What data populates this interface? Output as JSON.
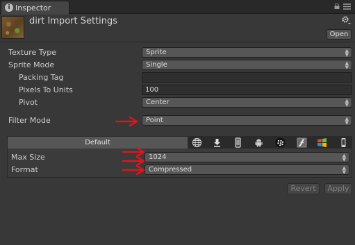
{
  "tab": {
    "label": "Inspector"
  },
  "header": {
    "title": "dirt Import Settings",
    "open_label": "Open"
  },
  "settings": {
    "texture_type": {
      "label": "Texture Type",
      "value": "Sprite"
    },
    "sprite_mode": {
      "label": "Sprite Mode",
      "value": "Single"
    },
    "packing_tag": {
      "label": "Packing Tag",
      "value": ""
    },
    "pixels_to_units": {
      "label": "Pixels To Units",
      "value": "100"
    },
    "pivot": {
      "label": "Pivot",
      "value": "Center"
    },
    "filter_mode": {
      "label": "Filter Mode",
      "value": "Point"
    }
  },
  "platform": {
    "default_tab": "Default",
    "icons": [
      "globe-icon",
      "download-icon",
      "iphone-icon",
      "android-icon",
      "blackberry-icon",
      "flash-icon",
      "windows-store-icon",
      "windows-phone-icon"
    ],
    "max_size": {
      "label": "Max Size",
      "value": "1024"
    },
    "format": {
      "label": "Format",
      "value": "Compressed"
    }
  },
  "actions": {
    "revert_label": "Revert",
    "apply_label": "Apply"
  },
  "colors": {
    "annotation_arrow": "#e0151b",
    "panel_bg": "#383838"
  }
}
